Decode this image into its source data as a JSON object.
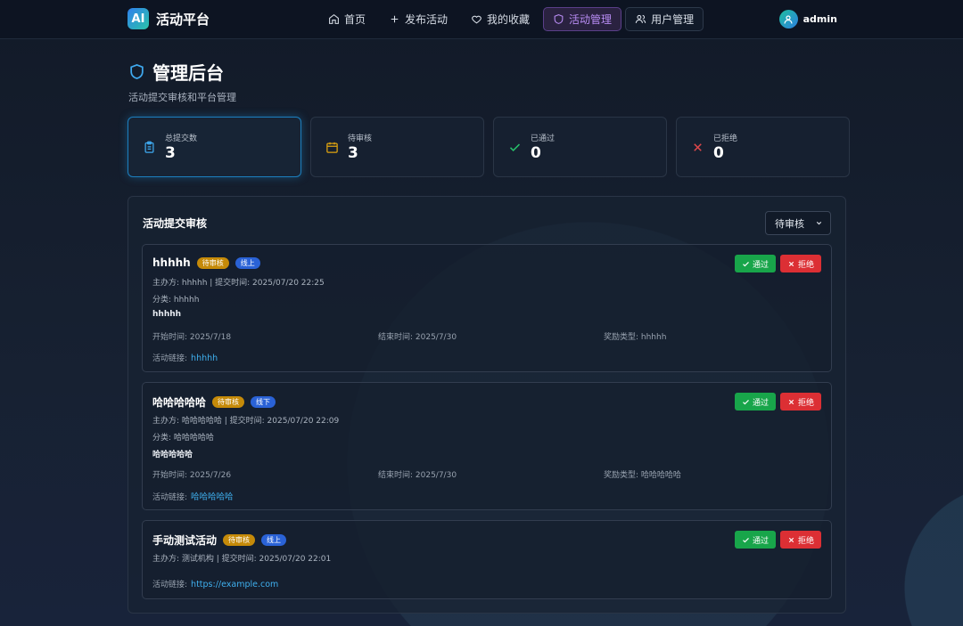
{
  "brand": {
    "logo": "AI",
    "name": "活动平台"
  },
  "nav": {
    "items": [
      {
        "label": "首页",
        "icon": "home-icon"
      },
      {
        "label": "发布活动",
        "icon": "plus-icon"
      },
      {
        "label": "我的收藏",
        "icon": "heart-icon"
      },
      {
        "label": "活动管理",
        "icon": "shield-icon",
        "active": true
      },
      {
        "label": "用户管理",
        "icon": "users-icon"
      }
    ]
  },
  "user": {
    "name": "admin"
  },
  "page": {
    "title": "管理后台",
    "subtitle": "活动提交审核和平台管理"
  },
  "stats": [
    {
      "label": "总提交数",
      "value": "3",
      "icon": "clipboard-icon",
      "color": "#3fa9ef"
    },
    {
      "label": "待审核",
      "value": "3",
      "icon": "calendar-icon",
      "color": "#e0a40f"
    },
    {
      "label": "已通过",
      "value": "0",
      "icon": "check-icon",
      "color": "#26c06a"
    },
    {
      "label": "已拒绝",
      "value": "0",
      "icon": "x-icon",
      "color": "#e0474b"
    }
  ],
  "panel": {
    "title": "活动提交审核",
    "filter_value": "待审核"
  },
  "actions": {
    "approve": "通过",
    "reject": "拒绝"
  },
  "submissions": [
    {
      "name": "hhhhh",
      "status": "待审核",
      "mode": "线上",
      "meta": "主办方: hhhhh | 提交时间: 2025/07/20 22:25",
      "category": "分类: hhhhh",
      "description": "hhhhh",
      "start": "开始时间: 2025/7/18",
      "end": "结束时间: 2025/7/30",
      "reward": "奖励类型: hhhhh",
      "link_label": "活动链接:",
      "link": "hhhhh"
    },
    {
      "name": "哈哈哈哈哈",
      "status": "待审核",
      "mode": "线下",
      "meta": "主办方: 哈哈哈哈哈 | 提交时间: 2025/07/20 22:09",
      "category": "分类: 哈哈哈哈哈",
      "description": "哈哈哈哈哈",
      "start": "开始时间: 2025/7/26",
      "end": "结束时间: 2025/7/30",
      "reward": "奖励类型: 哈哈哈哈哈",
      "link_label": "活动链接:",
      "link": "哈哈哈哈哈"
    },
    {
      "name": "手动测试活动",
      "status": "待审核",
      "mode": "线上",
      "meta": "主办方: 测试机构 | 提交时间: 2025/07/20 22:01",
      "link_label": "活动链接:",
      "link": "https://example.com"
    }
  ]
}
